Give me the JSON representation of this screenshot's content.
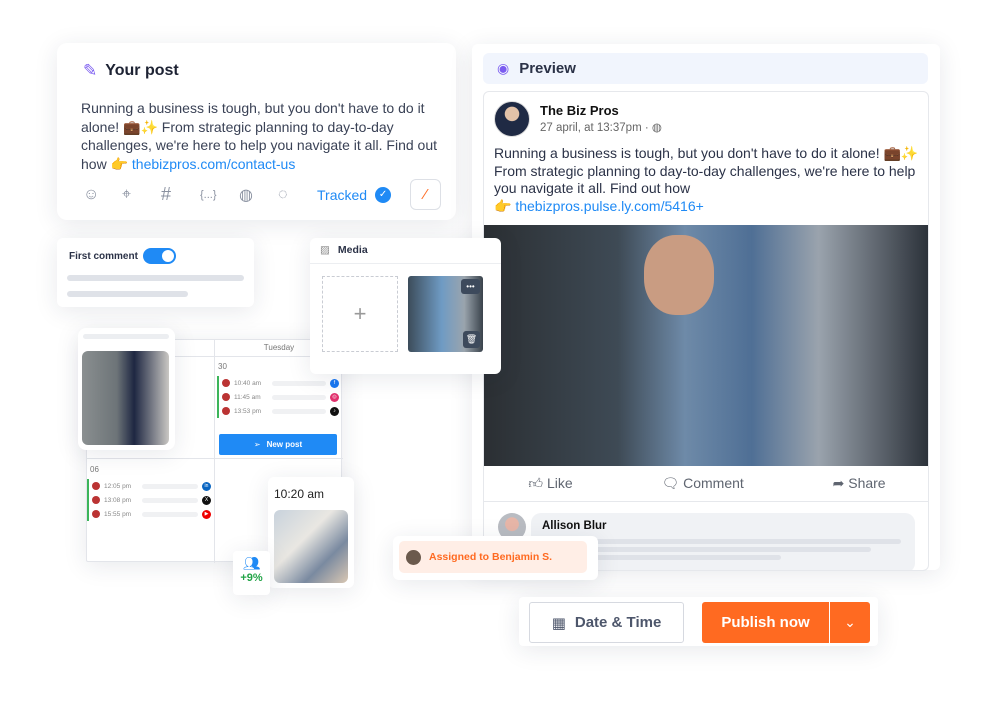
{
  "post": {
    "title": "Your post",
    "text": "Running a business is tough, but you don't have to do it alone! 💼✨ From strategic planning to day-to-day challenges, we're here to help you navigate it all. Find out how 👉 ",
    "link": "thebizpros.com/contact-us",
    "tracked": "Tracked",
    "toolbar_icons": [
      "emoji-icon",
      "location-icon",
      "hashtag-icon",
      "variables-icon",
      "globe-icon",
      "chat-icon",
      "magic-wand-icon"
    ]
  },
  "first_comment": {
    "label": "First comment",
    "enabled": true
  },
  "media": {
    "title": "Media",
    "add": "+"
  },
  "calendar": {
    "day": "Tuesday",
    "date1": "30",
    "date2": "06",
    "slots1": [
      {
        "time": "10:40 am",
        "network": "facebook"
      },
      {
        "time": "11:45 am",
        "network": "instagram"
      },
      {
        "time": "13:53 pm",
        "network": "tiktok"
      }
    ],
    "slots2": [
      {
        "time": "12:05 pm",
        "network": "linkedin"
      },
      {
        "time": "13:08 pm",
        "network": "x"
      },
      {
        "time": "15:55 pm",
        "network": "youtube"
      }
    ],
    "new_post": "New post"
  },
  "story": {
    "time": "10:20 am"
  },
  "growth": {
    "value": "+9%"
  },
  "assigned": {
    "text": "Assigned to Benjamin S."
  },
  "preview": {
    "title": "Preview",
    "page_name": "The Biz Pros",
    "date": "27 april, at 13:37pm ·",
    "text": "Running a business is tough, but you don't have to do it alone! 💼✨ From strategic planning to day-to-day challenges, we're here to help you navigate it all. Find out how",
    "link": "thebizpros.pulse.ly.com/5416+",
    "like": "Like",
    "comment": "Comment",
    "share": "Share",
    "commenter": "Allison Blur"
  },
  "actions": {
    "date_time": "Date & Time",
    "publish": "Publish now"
  },
  "colors": {
    "accent": "#1f8af5",
    "publish": "#ff6a21",
    "purple": "#7b5cf0"
  }
}
